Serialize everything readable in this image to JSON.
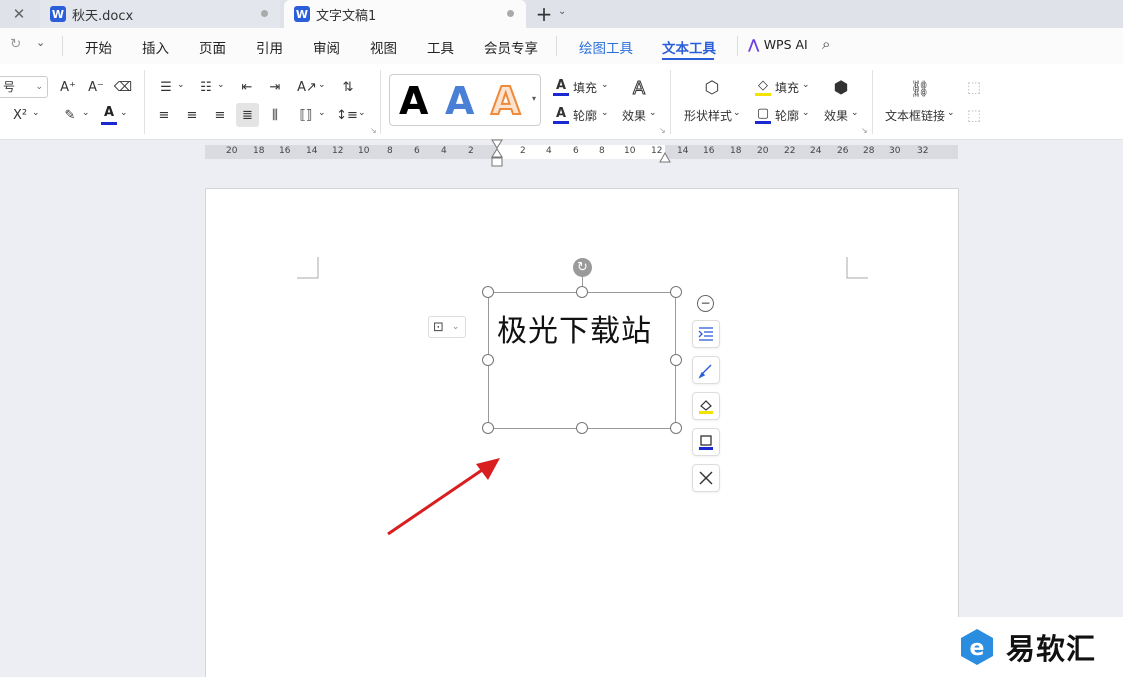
{
  "tabs": [
    {
      "label": "秋天.docx",
      "active": false
    },
    {
      "label": "文字文稿1",
      "active": true
    }
  ],
  "tab_icon_letter": "W",
  "new_tab_label": "+",
  "menu": {
    "items": [
      "开始",
      "插入",
      "页面",
      "引用",
      "审阅",
      "视图",
      "工具",
      "会员专享"
    ],
    "contextual": [
      "绘图工具",
      "文本工具"
    ],
    "current": "文本工具",
    "wps_ai": "WPS AI"
  },
  "ribbon": {
    "font_size_value": "号",
    "superscript_label": "X²",
    "style_gallery": [
      {
        "glyph": "A",
        "style": "black"
      },
      {
        "glyph": "A",
        "style": "blue"
      },
      {
        "glyph": "A",
        "style": "orange-outline"
      }
    ],
    "text_fill": "填充",
    "text_outline": "轮廓",
    "text_effect": "效果",
    "shape_style": "形状样式",
    "shape_fill": "填充",
    "shape_outline": "轮廓",
    "shape_effect": "效果",
    "textbox_link": "文本框链接"
  },
  "ruler": {
    "left_numbers": [
      "20",
      "18",
      "16",
      "14",
      "12",
      "10",
      "8",
      "6",
      "4",
      "2"
    ],
    "right_numbers": [
      "2",
      "4",
      "6",
      "8",
      "10",
      "12",
      "14",
      "16",
      "18",
      "20",
      "22",
      "24",
      "26",
      "28",
      "30",
      "32"
    ]
  },
  "document": {
    "textbox_text": "极光下载站"
  },
  "watermark": {
    "text": "易软汇"
  },
  "colors": {
    "accent": "#2b5fd9",
    "arrow": "#e02020",
    "fill_yellow": "#f4e300",
    "outline_blue": "#1a2ad0",
    "font_color_red": "#d00000"
  }
}
